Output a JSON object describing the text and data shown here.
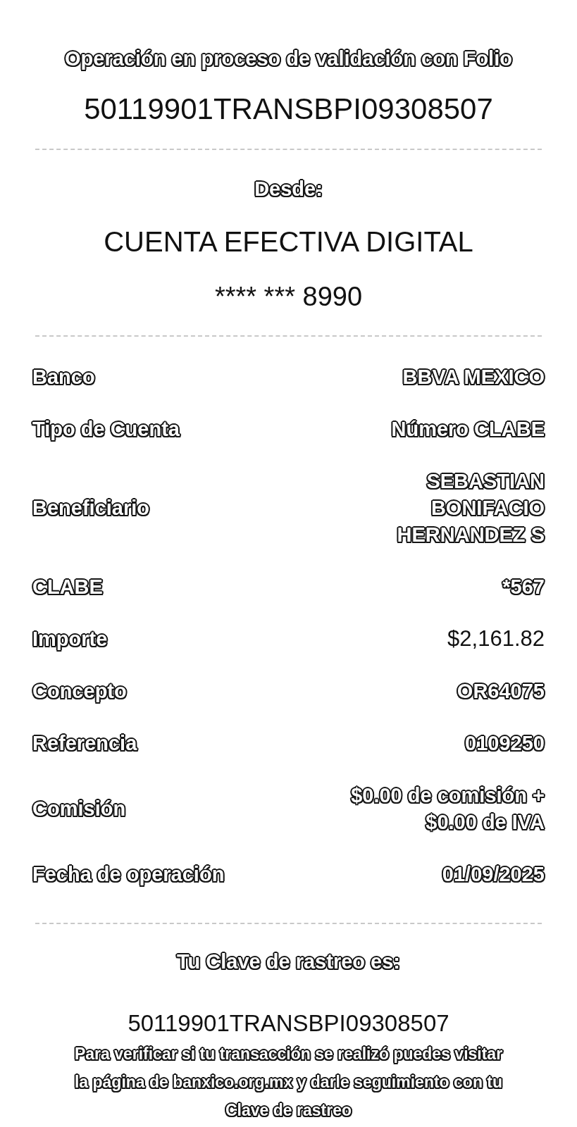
{
  "receipt_header": {
    "title": "Operación en proceso de validación con Folio",
    "folio": "50119901TRANSBPI09308507"
  },
  "origin": {
    "label": "Desde:",
    "account_name": "CUENTA EFECTIVA DIGITAL",
    "account_number": "**** *** 8990"
  },
  "details": [
    {
      "label": "Banco",
      "value": "BBVA MEXICO",
      "kind": "outlined"
    },
    {
      "label": "Tipo de Cuenta",
      "value": "Número CLABE",
      "kind": "outlined"
    },
    {
      "label": "Beneficiario",
      "value": "SEBASTIAN BONIFACIO HERNANDEZ S",
      "kind": "outlined"
    },
    {
      "label": "CLABE",
      "value": "*567",
      "kind": "outlined"
    },
    {
      "label": "Importe",
      "value": "$2,161.82",
      "kind": "plain"
    },
    {
      "label": "Concepto",
      "value": "OR64075",
      "kind": "outlined"
    },
    {
      "label": "Referencia",
      "value": "0109250",
      "kind": "outlined"
    },
    {
      "label": "Comisión",
      "value": "$0.00 de comisión + $0.00 de IVA",
      "kind": "outlined"
    },
    {
      "label": "Fecha de operación",
      "value": "01/09/2025",
      "kind": "outlined"
    }
  ],
  "tracking": {
    "label": "Tu Clave de rastreo es:",
    "key": "50119901TRANSBPI09308507",
    "note": "Para verificar si tu transacción se realizó puedes visitar la página de banxico.org.mx y darle seguimiento con tu Clave de rastreo"
  }
}
